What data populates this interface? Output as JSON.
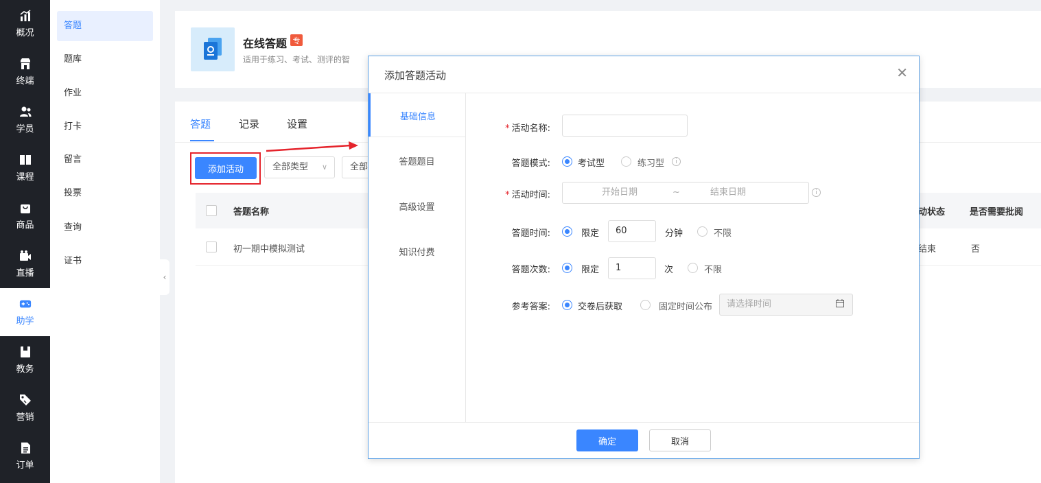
{
  "nav": {
    "items": [
      {
        "label": "概况",
        "icon": "chart-icon"
      },
      {
        "label": "终端",
        "icon": "store-icon"
      },
      {
        "label": "学员",
        "icon": "users-icon"
      },
      {
        "label": "课程",
        "icon": "book-icon"
      },
      {
        "label": "商品",
        "icon": "bag-icon"
      },
      {
        "label": "直播",
        "icon": "camera-icon"
      },
      {
        "label": "助学",
        "icon": "gamepad-icon"
      },
      {
        "label": "教务",
        "icon": "folder-icon"
      },
      {
        "label": "营销",
        "icon": "tag-icon"
      },
      {
        "label": "订单",
        "icon": "document-icon"
      }
    ],
    "active": "助学"
  },
  "subnav": {
    "items": [
      "答题",
      "题库",
      "作业",
      "打卡",
      "留言",
      "投票",
      "查询",
      "证书"
    ],
    "active": "答题"
  },
  "header": {
    "title": "在线答题",
    "badge": "专",
    "description": "适用于练习、考试、测评的智"
  },
  "tabs": [
    "答题",
    "记录",
    "设置"
  ],
  "toolbar": {
    "add_button": "添加活动",
    "filter_type": "全部类型",
    "filter_status": "全部"
  },
  "table": {
    "headers": {
      "name": "答题名称",
      "status": "动状态",
      "review": "是否需要批阅"
    },
    "rows": [
      {
        "name": "初一期中模拟测试",
        "status": "结束",
        "review": "否"
      }
    ]
  },
  "modal": {
    "title": "添加答题活动",
    "side_tabs": [
      "基础信息",
      "答题题目",
      "高级设置",
      "知识付费"
    ],
    "form": {
      "name_label": "活动名称:",
      "name_value": "",
      "mode_label": "答题模式:",
      "mode_options": [
        "考试型",
        "练习型"
      ],
      "time_label": "活动时间:",
      "start_placeholder": "开始日期",
      "range_sep": "~",
      "end_placeholder": "结束日期",
      "duration_label": "答题时间:",
      "duration_limit": "限定",
      "duration_value": "60",
      "duration_unit": "分钟",
      "duration_unlimited": "不限",
      "count_label": "答题次数:",
      "count_limit": "限定",
      "count_value": "1",
      "count_unit": "次",
      "count_unlimited": "不限",
      "answer_label": "参考答案:",
      "answer_option1": "交卷后获取",
      "answer_option2": "固定时间公布",
      "answer_time_placeholder": "请选择时间"
    },
    "ok_button": "确定",
    "cancel_button": "取消"
  },
  "colors": {
    "accent": "#3a86ff",
    "nav_bg": "#1f2228",
    "highlight": "#e5242c",
    "badge": "#f05a3c"
  }
}
